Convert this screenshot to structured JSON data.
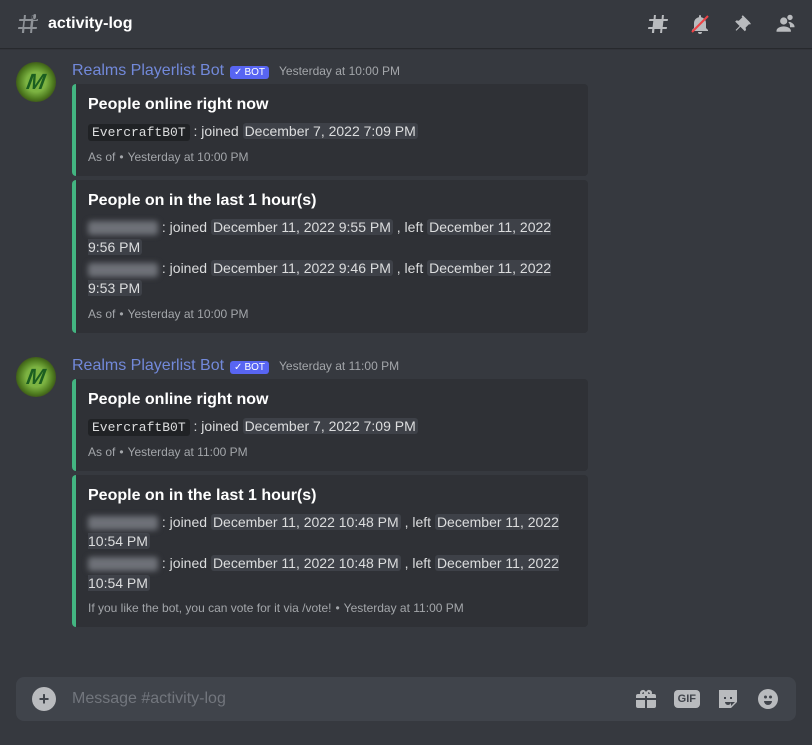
{
  "header": {
    "channel_name": "activity-log"
  },
  "messages": [
    {
      "author": "Realms Playerlist Bot",
      "bot_label": "BOT",
      "timestamp": "Yesterday at 10:00 PM",
      "embeds": [
        {
          "title": "People online right now",
          "lines": [
            {
              "user_code": "EvercraftB0T",
              "joined_label": ": joined",
              "joined_ts": "December 7, 2022 7:09 PM"
            }
          ],
          "footer_prefix": "As of",
          "footer_ts": "Yesterday at 10:00 PM"
        },
        {
          "title": "People on in the last 1 hour(s)",
          "lines": [
            {
              "user_blur": true,
              "joined_label": ": joined",
              "joined_ts": "December 11, 2022 9:55 PM",
              "left_label": ", left",
              "left_ts": "December 11, 2022 9:56 PM"
            },
            {
              "user_blur": true,
              "joined_label": ": joined",
              "joined_ts": "December 11, 2022 9:46 PM",
              "left_label": ", left",
              "left_ts": "December 11, 2022 9:53 PM"
            }
          ],
          "footer_prefix": "As of",
          "footer_ts": "Yesterday at 10:00 PM"
        }
      ]
    },
    {
      "author": "Realms Playerlist Bot",
      "bot_label": "BOT",
      "timestamp": "Yesterday at 11:00 PM",
      "embeds": [
        {
          "title": "People online right now",
          "lines": [
            {
              "user_code": "EvercraftB0T",
              "joined_label": ": joined",
              "joined_ts": "December 7, 2022 7:09 PM"
            }
          ],
          "footer_prefix": "As of",
          "footer_ts": "Yesterday at 11:00 PM"
        },
        {
          "title": "People on in the last 1 hour(s)",
          "lines": [
            {
              "user_blur": true,
              "joined_label": ": joined",
              "joined_ts": "December 11, 2022 10:48 PM",
              "left_label": ", left",
              "left_ts": "December 11, 2022 10:54 PM"
            },
            {
              "user_blur": true,
              "joined_label": ": joined",
              "joined_ts": "December 11, 2022 10:48 PM",
              "left_label": ", left",
              "left_ts": "December 11, 2022 10:54 PM"
            }
          ],
          "footer_prefix": "If you like the bot, you can vote for it via /vote!",
          "footer_ts": "Yesterday at 11:00 PM"
        }
      ]
    }
  ],
  "input": {
    "placeholder": "Message #activity-log",
    "gif_label": "GIF"
  }
}
